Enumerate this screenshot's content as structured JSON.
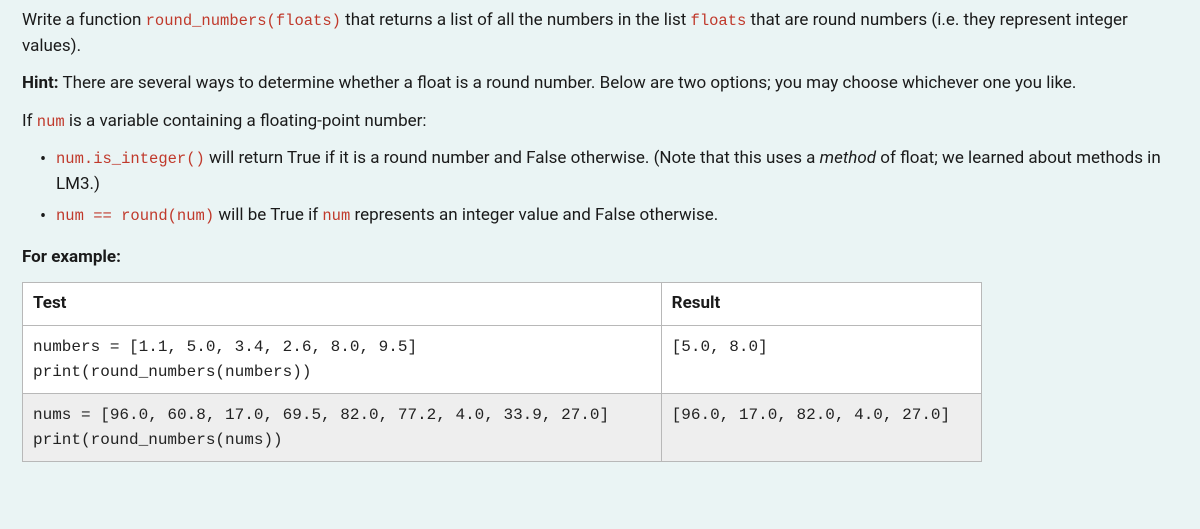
{
  "intro": {
    "p1_pre": "Write a function ",
    "p1_code1": "round_numbers(floats)",
    "p1_mid": " that returns a list of all the numbers in the list ",
    "p1_code2": "floats",
    "p1_post": " that are round numbers (i.e. they represent integer values)."
  },
  "hint": {
    "label": "Hint:",
    "text": " There are several ways to determine whether a float is a round number. Below are two options; you may choose whichever one you like."
  },
  "ifline": {
    "pre": "If ",
    "code": "num",
    "post": " is a variable containing a floating-point number:"
  },
  "bullets": {
    "b1_code": "num.is_integer()",
    "b1_text1": " will return True if it is a round number and False otherwise. (Note that this uses a ",
    "b1_em": "method",
    "b1_text2": " of float; we learned about methods in LM3.)",
    "b2_code1": "num == round(num)",
    "b2_mid": " will be True if ",
    "b2_code2": "num",
    "b2_post": " represents an integer value and False otherwise."
  },
  "example_label": "For example:",
  "table": {
    "headers": {
      "test": "Test",
      "result": "Result"
    },
    "rows": [
      {
        "test": "numbers = [1.1, 5.0, 3.4, 2.6, 8.0, 9.5]\nprint(round_numbers(numbers))",
        "result": "[5.0, 8.0]"
      },
      {
        "test": "nums = [96.0, 60.8, 17.0, 69.5, 82.0, 77.2, 4.0, 33.9, 27.0]\nprint(round_numbers(nums))",
        "result": "[96.0, 17.0, 82.0, 4.0, 27.0]"
      }
    ]
  }
}
